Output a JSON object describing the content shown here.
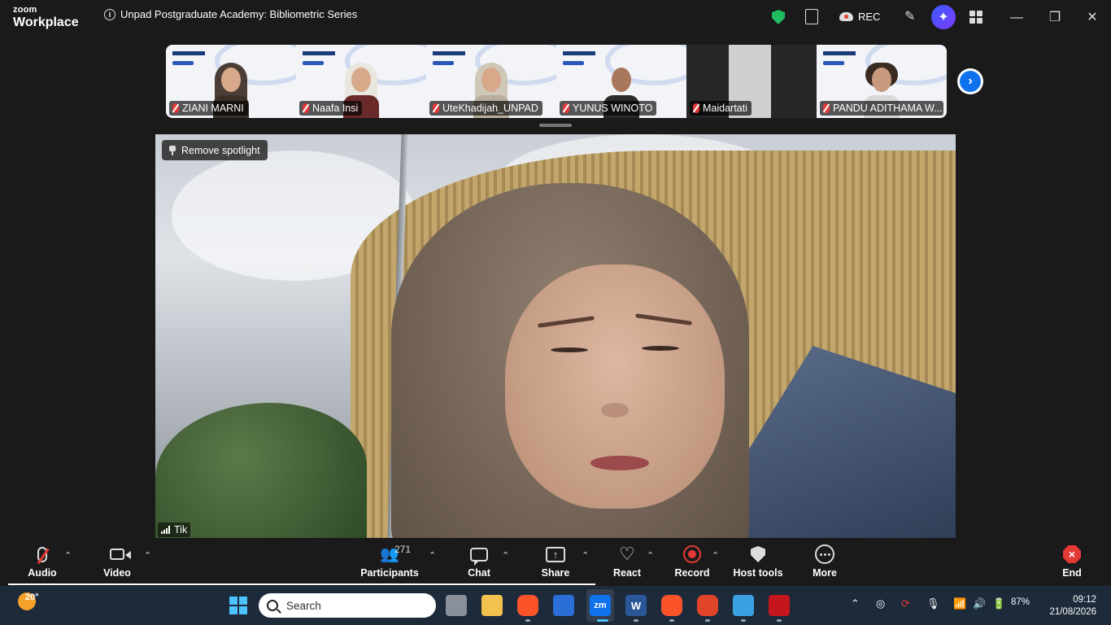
{
  "app": {
    "brand_line1": "zoom",
    "brand_line2": "Workplace",
    "meeting_title": "Unpad Postgraduate Academy: Bibliometric Series"
  },
  "titlebar": {
    "rec_label": "REC",
    "minimize": "—",
    "restore": "❐",
    "close": "✕"
  },
  "gallery": {
    "participants": [
      {
        "name": "ZIANI MARNI"
      },
      {
        "name": "Naafa Insi"
      },
      {
        "name": "UteKhadijah_UNPAD"
      },
      {
        "name": "YUNUS WINOTO"
      },
      {
        "name": "Maidartati"
      },
      {
        "name": "PANDU ADITHAMA W..."
      }
    ],
    "next_glyph": "›"
  },
  "main_video": {
    "spotlight_button": "Remove spotlight",
    "speaker_name": "Tik"
  },
  "toolbar": {
    "audio": "Audio",
    "video": "Video",
    "participants": "Participants",
    "participant_count": "271",
    "chat": "Chat",
    "share": "Share",
    "react": "React",
    "record": "Record",
    "host_tools": "Host tools",
    "more": "More",
    "end": "End",
    "caret": "⌃"
  },
  "taskbar": {
    "weather_temp": "20°",
    "search_placeholder": "Search",
    "battery": "87%",
    "time": "09:12",
    "date": "21/08/2026"
  },
  "colors": {
    "accent": "#0e72ed",
    "danger": "#e53935",
    "secure": "#1fbd60"
  }
}
